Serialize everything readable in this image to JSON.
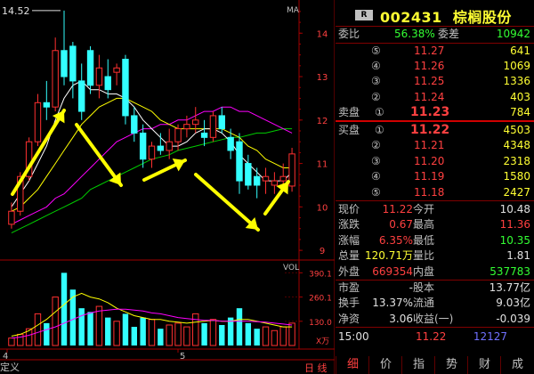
{
  "chart_top": {
    "corner_label": "MA",
    "price_marker": "14.52",
    "price_axis": [
      "14",
      "13",
      "12",
      "11",
      "10",
      "9"
    ],
    "date_labels": [
      "4",
      "5"
    ],
    "left_edge_label": "定义",
    "period_tab": "日 线",
    "colors": {
      "up": "#ff3030",
      "down": "#33ffff",
      "ma5": "#ffffff",
      "ma10": "#ffff00",
      "ma20": "#ff00ff",
      "ma60": "#00cc00",
      "arrow": "#ffff00"
    }
  },
  "chart_data": [
    {
      "type": "candlestick",
      "note": "price panel",
      "ylim": [
        8.9,
        14.6
      ],
      "candles": [
        {
          "o": 9.6,
          "h": 10.1,
          "l": 9.5,
          "c": 9.9
        },
        {
          "o": 9.9,
          "h": 10.8,
          "l": 9.8,
          "c": 10.7
        },
        {
          "o": 10.7,
          "h": 11.6,
          "l": 10.6,
          "c": 11.5
        },
        {
          "o": 11.5,
          "h": 12.6,
          "l": 11.4,
          "c": 12.4
        },
        {
          "o": 12.4,
          "h": 12.9,
          "l": 12.0,
          "c": 12.3
        },
        {
          "o": 12.3,
          "h": 13.9,
          "l": 12.2,
          "c": 13.6
        },
        {
          "o": 13.6,
          "h": 14.52,
          "l": 12.8,
          "c": 13.0
        },
        {
          "o": 13.7,
          "h": 13.8,
          "l": 12.5,
          "c": 12.9
        },
        {
          "o": 12.9,
          "h": 13.3,
          "l": 12.0,
          "c": 12.2
        },
        {
          "o": 13.6,
          "h": 13.7,
          "l": 12.6,
          "c": 12.8
        },
        {
          "o": 12.8,
          "h": 13.5,
          "l": 12.5,
          "c": 13.2
        },
        {
          "o": 13.0,
          "h": 13.4,
          "l": 12.5,
          "c": 12.7
        },
        {
          "o": 13.1,
          "h": 13.3,
          "l": 12.8,
          "c": 13.2
        },
        {
          "o": 13.4,
          "h": 13.5,
          "l": 11.9,
          "c": 12.1
        },
        {
          "o": 12.1,
          "h": 12.3,
          "l": 11.5,
          "c": 11.7
        },
        {
          "o": 11.7,
          "h": 11.9,
          "l": 10.9,
          "c": 11.1
        },
        {
          "o": 11.1,
          "h": 11.5,
          "l": 10.9,
          "c": 11.4
        },
        {
          "o": 11.4,
          "h": 11.7,
          "l": 11.2,
          "c": 11.3
        },
        {
          "o": 11.3,
          "h": 11.8,
          "l": 11.1,
          "c": 11.5
        },
        {
          "o": 11.5,
          "h": 11.9,
          "l": 11.3,
          "c": 11.8
        },
        {
          "o": 11.8,
          "h": 12.1,
          "l": 11.6,
          "c": 11.9
        },
        {
          "o": 11.9,
          "h": 12.3,
          "l": 11.7,
          "c": 12.0
        },
        {
          "o": 11.7,
          "h": 12.0,
          "l": 11.4,
          "c": 11.6
        },
        {
          "o": 11.6,
          "h": 12.2,
          "l": 11.5,
          "c": 12.1
        },
        {
          "o": 12.1,
          "h": 12.3,
          "l": 11.7,
          "c": 11.8
        },
        {
          "o": 11.6,
          "h": 11.8,
          "l": 11.1,
          "c": 11.3
        },
        {
          "o": 11.5,
          "h": 11.7,
          "l": 10.3,
          "c": 10.6
        },
        {
          "o": 11.0,
          "h": 11.2,
          "l": 10.4,
          "c": 10.5
        },
        {
          "o": 10.7,
          "h": 10.9,
          "l": 10.2,
          "c": 10.5
        },
        {
          "o": 10.6,
          "h": 10.9,
          "l": 10.3,
          "c": 10.7
        },
        {
          "o": 10.5,
          "h": 10.8,
          "l": 10.3,
          "c": 10.6
        },
        {
          "o": 10.6,
          "h": 11.0,
          "l": 10.5,
          "c": 10.7
        },
        {
          "o": 10.48,
          "h": 11.36,
          "l": 10.35,
          "c": 11.22
        }
      ],
      "ma5": [
        10.0,
        10.3,
        10.6,
        11.0,
        11.4,
        12.0,
        12.5,
        12.8,
        12.9,
        12.7,
        12.7,
        12.6,
        12.6,
        12.5,
        12.3,
        12.0,
        11.8,
        11.6,
        11.4,
        11.4,
        11.5,
        11.7,
        11.8,
        11.8,
        11.7,
        11.5,
        11.2,
        11.0,
        10.8,
        10.6,
        10.6,
        10.6,
        10.8
      ],
      "ma10": [
        9.9,
        10.0,
        10.2,
        10.4,
        10.7,
        11.0,
        11.3,
        11.6,
        11.9,
        12.1,
        12.3,
        12.4,
        12.5,
        12.5,
        12.4,
        12.3,
        12.2,
        12.0,
        11.9,
        11.8,
        11.8,
        11.8,
        11.8,
        11.8,
        11.8,
        11.7,
        11.6,
        11.4,
        11.3,
        11.1,
        11.0,
        10.9,
        10.9
      ],
      "ma20": [
        9.6,
        9.7,
        9.8,
        9.9,
        10.0,
        10.2,
        10.3,
        10.5,
        10.7,
        10.9,
        11.1,
        11.3,
        11.5,
        11.6,
        11.7,
        11.8,
        11.8,
        11.9,
        11.9,
        12.0,
        12.0,
        12.1,
        12.2,
        12.2,
        12.3,
        12.3,
        12.2,
        12.2,
        12.1,
        12.0,
        11.9,
        11.8,
        11.7
      ],
      "ma60": [
        9.4,
        9.5,
        9.6,
        9.7,
        9.8,
        9.9,
        10.0,
        10.1,
        10.2,
        10.4,
        10.5,
        10.6,
        10.7,
        10.8,
        10.9,
        11.0,
        11.1,
        11.15,
        11.2,
        11.3,
        11.35,
        11.4,
        11.45,
        11.5,
        11.55,
        11.6,
        11.6,
        11.65,
        11.7,
        11.7,
        11.75,
        11.8,
        11.8
      ]
    },
    {
      "type": "bar",
      "note": "volume panel",
      "ylabel": "X万",
      "tick_labels": [
        "390.1",
        "260.1",
        "130.0"
      ],
      "corner_label": "VOL",
      "ylim": [
        0,
        430
      ],
      "values": [
        40,
        60,
        90,
        170,
        120,
        260,
        390,
        300,
        200,
        180,
        210,
        150,
        130,
        170,
        100,
        150,
        140,
        90,
        110,
        120,
        100,
        170,
        120,
        140,
        110,
        150,
        200,
        120,
        90,
        100,
        80,
        100,
        120
      ],
      "ma_a": [
        50,
        60,
        80,
        110,
        140,
        180,
        220,
        260,
        280,
        260,
        250,
        230,
        200,
        180,
        160,
        150,
        140,
        140,
        130,
        125,
        120,
        125,
        130,
        135,
        130,
        130,
        140,
        140,
        130,
        120,
        110,
        100,
        100
      ],
      "ma_b": [
        40,
        45,
        55,
        70,
        85,
        100,
        120,
        140,
        160,
        175,
        185,
        190,
        195,
        195,
        190,
        185,
        175,
        170,
        160,
        150,
        145,
        140,
        135,
        135,
        130,
        130,
        130,
        130,
        128,
        125,
        120,
        115,
        110
      ]
    }
  ],
  "quote": {
    "badge": "R",
    "code": "002431",
    "name": "棕榈股份",
    "weibi_label": "委比",
    "weibi_value": "56.38%",
    "weicha_label": "委差",
    "weicha_value": "10942",
    "sell_label": "卖盘",
    "buy_label": "买盘",
    "sell": [
      {
        "idx": "⑤",
        "price": "11.27",
        "vol": "641"
      },
      {
        "idx": "④",
        "price": "11.26",
        "vol": "1069"
      },
      {
        "idx": "③",
        "price": "11.25",
        "vol": "1336"
      },
      {
        "idx": "②",
        "price": "11.24",
        "vol": "403"
      },
      {
        "idx": "①",
        "price": "11.23",
        "vol": "784"
      }
    ],
    "buy": [
      {
        "idx": "①",
        "price": "11.22",
        "vol": "4503"
      },
      {
        "idx": "②",
        "price": "11.21",
        "vol": "4348"
      },
      {
        "idx": "③",
        "price": "11.20",
        "vol": "2318"
      },
      {
        "idx": "④",
        "price": "11.19",
        "vol": "1580"
      },
      {
        "idx": "⑤",
        "price": "11.18",
        "vol": "2427"
      }
    ],
    "stats": [
      {
        "l1": "现价",
        "v1": "11.22",
        "c1": "red",
        "l2": "今开",
        "v2": "10.48",
        "c2": "white"
      },
      {
        "l1": "涨跌",
        "v1": "0.67",
        "c1": "red",
        "l2": "最高",
        "v2": "11.36",
        "c2": "red"
      },
      {
        "l1": "涨幅",
        "v1": "6.35%",
        "c1": "red",
        "l2": "最低",
        "v2": "10.35",
        "c2": "green"
      },
      {
        "l1": "总量",
        "v1": "120.71万",
        "c1": "yellow",
        "l2": "量比",
        "v2": "1.81",
        "c2": "white"
      },
      {
        "l1": "外盘",
        "v1": "669354",
        "c1": "red",
        "l2": "内盘",
        "v2": "537783",
        "c2": "green"
      }
    ],
    "stats2": [
      {
        "l1": "市盈",
        "v1": "-",
        "l2": "股本",
        "v2": "13.77亿"
      },
      {
        "l1": "换手",
        "v1": "13.37%",
        "l2": "流通",
        "v2": "9.03亿"
      },
      {
        "l1": "净资",
        "v1": "3.06",
        "l2": "收益(一)",
        "v2": "-0.039"
      }
    ],
    "tick": {
      "time": "15:00",
      "price": "11.22",
      "vol": "12127"
    }
  },
  "tabs": [
    "细",
    "价",
    "指",
    "势",
    "财",
    "成"
  ]
}
